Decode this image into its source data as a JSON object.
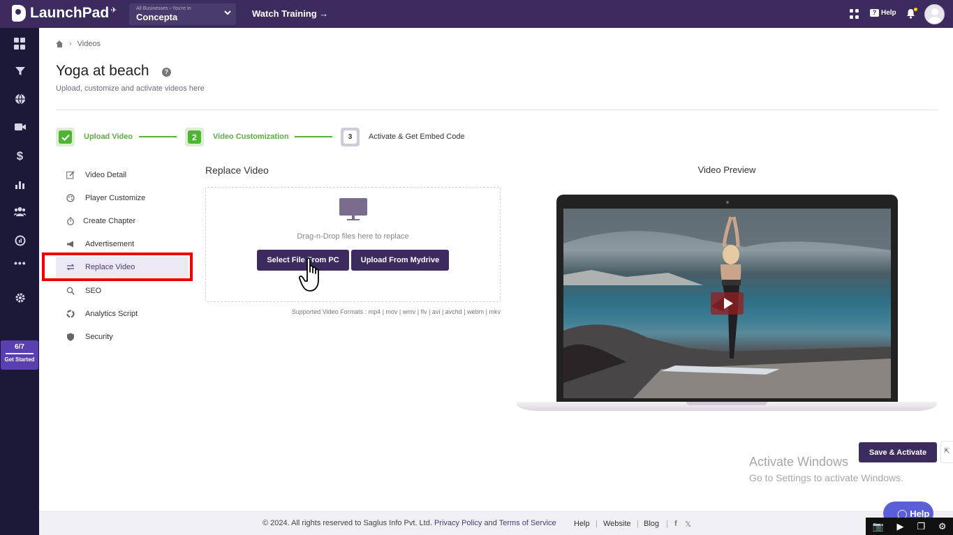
{
  "topbar": {
    "app_name": "LaunchPad",
    "business_small": "All Businesses › You're In",
    "business_name": "Concepta",
    "watch_training": "Watch Training →",
    "help_label": "Help"
  },
  "sidebar": {
    "get_started_count": "6/7",
    "get_started_label": "Get Started"
  },
  "breadcrumb": {
    "current": "Videos"
  },
  "page": {
    "title": "Yoga at beach",
    "subtitle": "Upload, customize and activate videos here"
  },
  "steps": [
    {
      "num": "",
      "label": "Upload Video"
    },
    {
      "num": "2",
      "label": "Video Customization"
    },
    {
      "num": "3",
      "label": "Activate & Get Embed Code"
    }
  ],
  "menu": [
    {
      "label": "Video Detail",
      "icon": "edit-icon"
    },
    {
      "label": "Player Customize",
      "icon": "palette-icon"
    },
    {
      "label": "Create Chapter",
      "icon": "timer-icon"
    },
    {
      "label": "Advertisement",
      "icon": "megaphone-icon"
    },
    {
      "label": "Replace Video",
      "icon": "swap-icon"
    },
    {
      "label": "SEO",
      "icon": "search-icon"
    },
    {
      "label": "Analytics Script",
      "icon": "chart-pie-icon"
    },
    {
      "label": "Security",
      "icon": "shield-icon"
    }
  ],
  "replace": {
    "title": "Replace Video",
    "drop_text": "Drag-n-Drop files here to replace",
    "select_btn": "Select File From PC",
    "mydrive_btn": "Upload From Mydrive",
    "formats": "Supported Video Formats : mp4 | mov | wmv | flv | avi | avchd | webm | mkv"
  },
  "preview": {
    "title": "Video Preview"
  },
  "save_btn": "Save & Activate",
  "windows": {
    "title": "Activate Windows",
    "sub": "Go to Settings to activate Windows."
  },
  "footer": {
    "copyright": "©  2024. All rights reserved to Saglus Info Pvt. Ltd.",
    "privacy": "Privacy Policy",
    "and": "and",
    "terms": "Terms of Service",
    "help": "Help",
    "website": "Website",
    "blog": "Blog"
  },
  "help_bubble": "Help",
  "colors": {
    "brand": "#3b2b5e",
    "accent_green": "#5aae3c",
    "highlight_red": "#ec0000"
  }
}
